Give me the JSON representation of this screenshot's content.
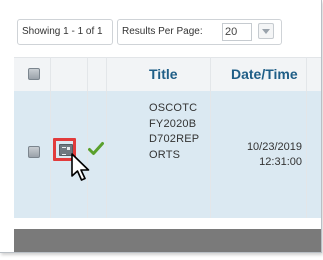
{
  "toolbar": {
    "showing_text": "Showing 1 - 1 of 1",
    "results_per_page_label": "Results Per Page:",
    "results_per_page_value": "20"
  },
  "table": {
    "columns": [
      "Title",
      "Date/Time"
    ],
    "rows": [
      {
        "title": "OSCOTCFY2020BD702REPORTS",
        "date": "10/23/2019",
        "time": "12:31:00"
      }
    ]
  },
  "icons": {
    "form_icon": "document-form-icon",
    "status_icon": "green-check-icon",
    "cursor": "arrow-cursor-icon"
  },
  "colors": {
    "header_text": "#1f5e87",
    "row_background": "#dbe9f2",
    "highlight": "#e23b3b",
    "check": "#5aa02c",
    "footer": "#7a7a7a"
  }
}
